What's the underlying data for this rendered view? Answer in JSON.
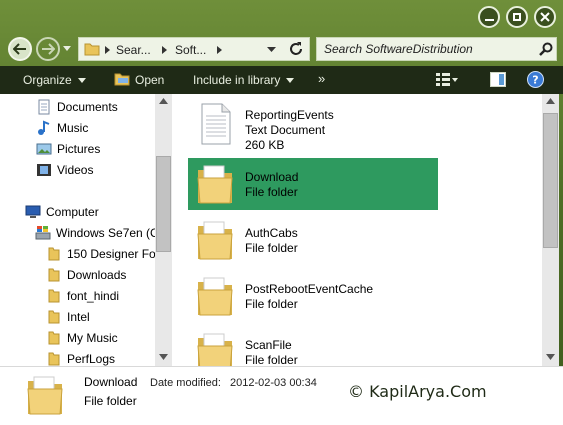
{
  "window": {
    "minimize_icon": "minimize-icon",
    "maximize_icon": "maximize-icon",
    "close_icon": "close-icon"
  },
  "address": {
    "crumbs": [
      "Sear...",
      "Soft..."
    ]
  },
  "search": {
    "placeholder": "Search SoftwareDistribution"
  },
  "toolbar": {
    "organize": "Organize",
    "open": "Open",
    "include": "Include in library",
    "more": "»"
  },
  "nav": {
    "libraries": [
      "Documents",
      "Music",
      "Pictures",
      "Videos"
    ],
    "computer": "Computer",
    "drive": "Windows Se7en (C",
    "folders": [
      "150 Designer For",
      "Downloads",
      "font_hindi",
      "Intel",
      "My Music",
      "PerfLogs"
    ]
  },
  "files": [
    {
      "name": "ReportingEvents",
      "type": "Text Document",
      "size": "260 KB",
      "icon": "text-document-icon"
    },
    {
      "name": "Download",
      "type": "File folder",
      "icon": "folder-icon",
      "selected": true
    },
    {
      "name": "AuthCabs",
      "type": "File folder",
      "icon": "folder-icon"
    },
    {
      "name": "PostRebootEventCache",
      "type": "File folder",
      "icon": "folder-icon"
    },
    {
      "name": "ScanFile",
      "type": "File folder",
      "icon": "folder-icon"
    }
  ],
  "details": {
    "name": "Download",
    "type": "File folder",
    "date_label": "Date modified:",
    "date_value": "2012-02-03 00:34"
  },
  "watermark": "© KapilArya.Com",
  "colors": {
    "selection": "#2e9a5f",
    "toolbar": "#1f2a16",
    "background": "#4f6f26"
  }
}
